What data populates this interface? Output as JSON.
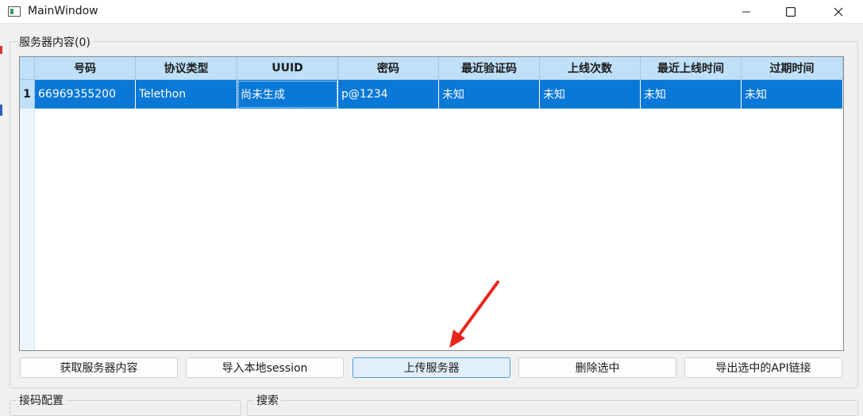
{
  "window": {
    "title": "MainWindow"
  },
  "server_group": {
    "title": "服务器内容(0)"
  },
  "table": {
    "columns": [
      "号码",
      "协议类型",
      "UUID",
      "密码",
      "最近验证码",
      "上线次数",
      "最近上线时间",
      "过期时间"
    ],
    "rows": [
      {
        "index": "1",
        "cells": [
          "66969355200",
          "Telethon",
          "尚未生成",
          "p@1234",
          "未知",
          "未知",
          "未知",
          "未知"
        ]
      }
    ]
  },
  "buttons": {
    "fetch_server": "获取服务器内容",
    "import_session": "导入本地session",
    "upload_server": "上传服务器",
    "delete_selected": "删除选中",
    "export_api": "导出选中的API链接"
  },
  "code_group": {
    "title": "接码配置"
  },
  "search_group": {
    "title": "搜索"
  },
  "colors": {
    "selection": "#0a78d7",
    "header": "#bfe0f8",
    "annotation_arrow": "#e8251c"
  }
}
